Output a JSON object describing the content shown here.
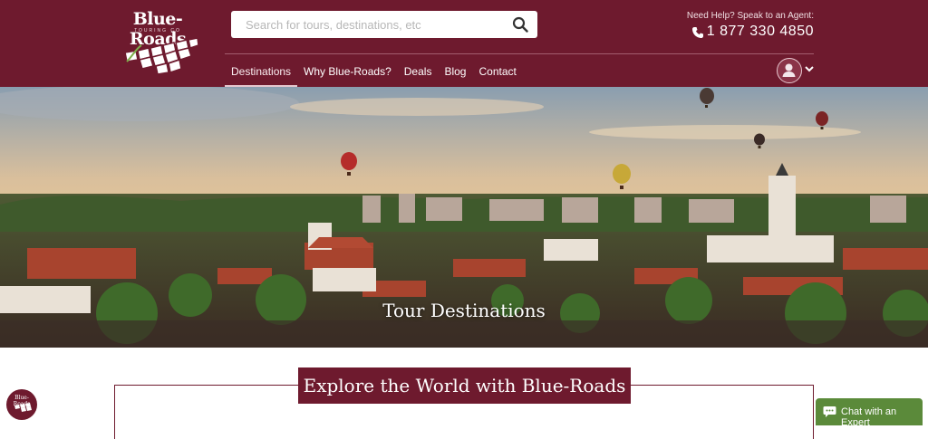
{
  "brand": {
    "name": "Blue-Roads",
    "tagline": "TOURING CO"
  },
  "search": {
    "placeholder": "Search for tours, destinations, etc"
  },
  "help": {
    "label": "Need Help? Speak to an Agent:",
    "phone": "1 877 330 4850"
  },
  "nav": {
    "items": [
      {
        "label": "Destinations",
        "active": true
      },
      {
        "label": "Why Blue-Roads?"
      },
      {
        "label": "Deals"
      },
      {
        "label": "Blog"
      },
      {
        "label": "Contact"
      }
    ]
  },
  "hero": {
    "title": "Tour Destinations"
  },
  "section": {
    "title": "Explore the World with Blue-Roads"
  },
  "mini_logo": {
    "text": "Blue-Roads"
  },
  "chat": {
    "label": "Chat with an Expert"
  },
  "colors": {
    "brand": "#6e1a2e",
    "chat": "#5b8a3a"
  }
}
